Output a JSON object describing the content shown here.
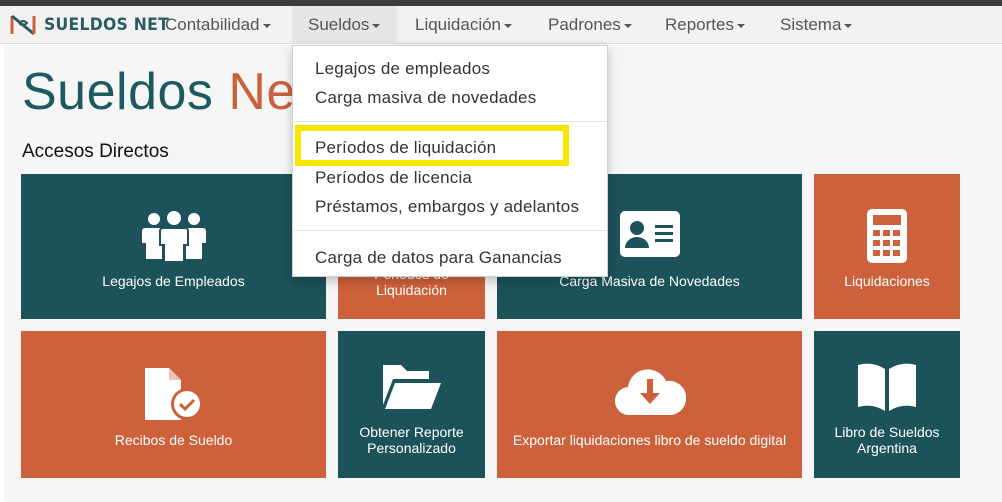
{
  "brand": {
    "name": "SUELDOS NET"
  },
  "nav": {
    "items": [
      {
        "label": "Contabilidad"
      },
      {
        "label": "Sueldos"
      },
      {
        "label": "Liquidación"
      },
      {
        "label": "Padrones"
      },
      {
        "label": "Reportes"
      },
      {
        "label": "Sistema"
      }
    ],
    "active": "Sueldos"
  },
  "hero": {
    "part1": "Sueldos ",
    "part2": "Net"
  },
  "section_title": "Accesos Directos",
  "tiles": [
    {
      "label": "Legajos de Empleados",
      "icon": "users-icon"
    },
    {
      "label": "Periodos de Liquidación",
      "icon": "calendar-icon"
    },
    {
      "label": "Carga Masiva de Novedades",
      "icon": "id-card-icon"
    },
    {
      "label": "Liquidaciones",
      "icon": "calculator-icon"
    },
    {
      "label": "Recibos de Sueldo",
      "icon": "file-check-icon"
    },
    {
      "label": "Obtener Reporte Personalizado",
      "icon": "folder-open-icon"
    },
    {
      "label": "Exportar liquidaciones libro de sueldo digital",
      "icon": "cloud-download-icon"
    },
    {
      "label": "Libro de Sueldos Argentina",
      "icon": "book-open-icon"
    }
  ],
  "dropdown": {
    "items": [
      "Legajos de empleados",
      "Carga masiva de novedades",
      "Períodos de liquidación",
      "Períodos de licencia",
      "Préstamos, embargos y adelantos",
      "Carga de datos para Ganancias"
    ],
    "highlighted": "Períodos de liquidación"
  },
  "colors": {
    "teal": "#1c525a",
    "orange": "#cc613b",
    "highlight": "#f6e600",
    "navbar": "#f2f2f2"
  }
}
